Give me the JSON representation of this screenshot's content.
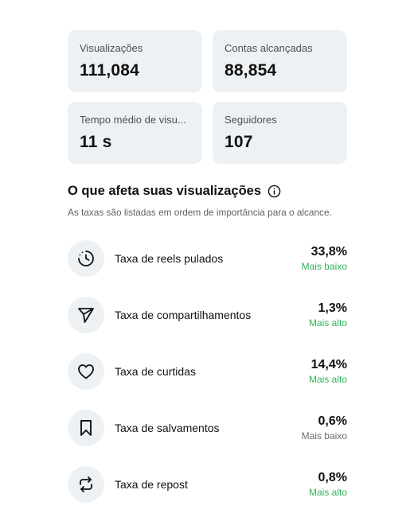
{
  "stats": [
    {
      "label": "Visualizações",
      "value": "111,084"
    },
    {
      "label": "Contas alcançadas",
      "value": "88,854"
    },
    {
      "label": "Tempo médio de visu...",
      "value": "11 s"
    },
    {
      "label": "Seguidores",
      "value": "107"
    }
  ],
  "section": {
    "title": "O que afeta suas visualizações",
    "subtitle": "As taxas são listadas em ordem de importância para o alcance.",
    "info_icon": "info-icon"
  },
  "metrics": [
    {
      "icon": "skip-timer-icon",
      "label": "Taxa de reels pulados",
      "value": "33,8%",
      "note": "Mais baixo"
    },
    {
      "icon": "share-icon",
      "label": "Taxa de compartilhamentos",
      "value": "1,3%",
      "note": "Mais alto"
    },
    {
      "icon": "heart-icon",
      "label": "Taxa de curtidas",
      "value": "14,4%",
      "note": "Mais alto"
    },
    {
      "icon": "bookmark-icon",
      "label": "Taxa de salvamentos",
      "value": "0,6%",
      "note": "Mais baixo"
    },
    {
      "icon": "repost-icon",
      "label": "Taxa de repost",
      "value": "0,8%",
      "note": "Mais alto"
    }
  ],
  "colors": {
    "card_bg": "#eef1f4",
    "positive": "#2fb35b",
    "neutral": "#6b6f75",
    "text": "#111111"
  }
}
